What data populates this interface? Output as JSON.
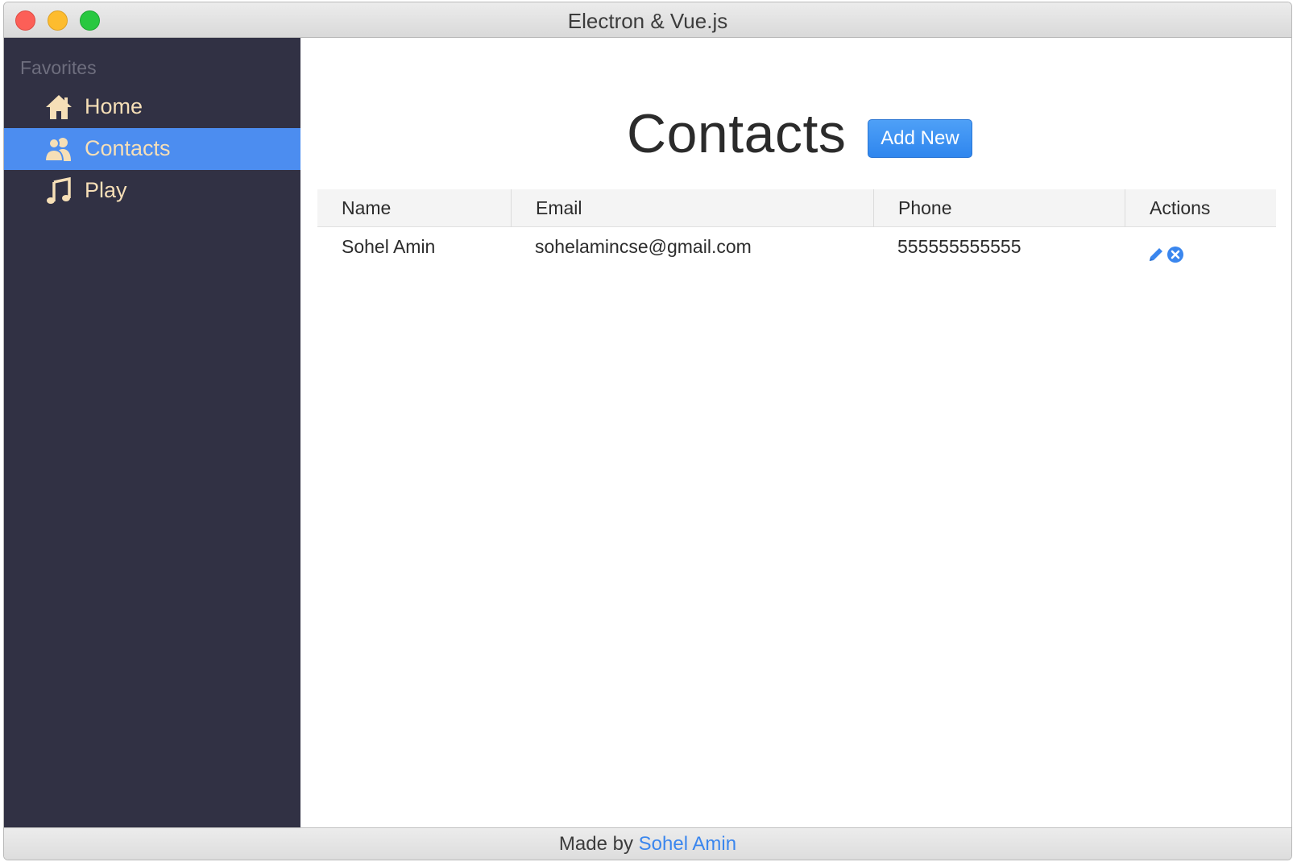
{
  "window": {
    "title": "Electron & Vue.js"
  },
  "sidebar": {
    "heading": "Favorites",
    "items": [
      {
        "label": "Home",
        "icon": "home-icon",
        "active": false
      },
      {
        "label": "Contacts",
        "icon": "users-icon",
        "active": true
      },
      {
        "label": "Play",
        "icon": "music-note-icon",
        "active": false
      }
    ]
  },
  "main": {
    "title": "Contacts",
    "add_button": "Add New",
    "table": {
      "headers": [
        "Name",
        "Email",
        "Phone",
        "Actions"
      ],
      "rows": [
        {
          "name": "Sohel Amin",
          "email": "sohelamincse@gmail.com",
          "phone": "555555555555",
          "actions": [
            "edit-icon",
            "delete-icon"
          ]
        }
      ]
    }
  },
  "footer": {
    "prefix": "Made by",
    "author": "Sohel Amin"
  },
  "colors": {
    "sidebar_bg": "#313144",
    "active_item": "#4c8df0",
    "nav_text": "#f6dfb7",
    "accent": "#3a86ee"
  }
}
